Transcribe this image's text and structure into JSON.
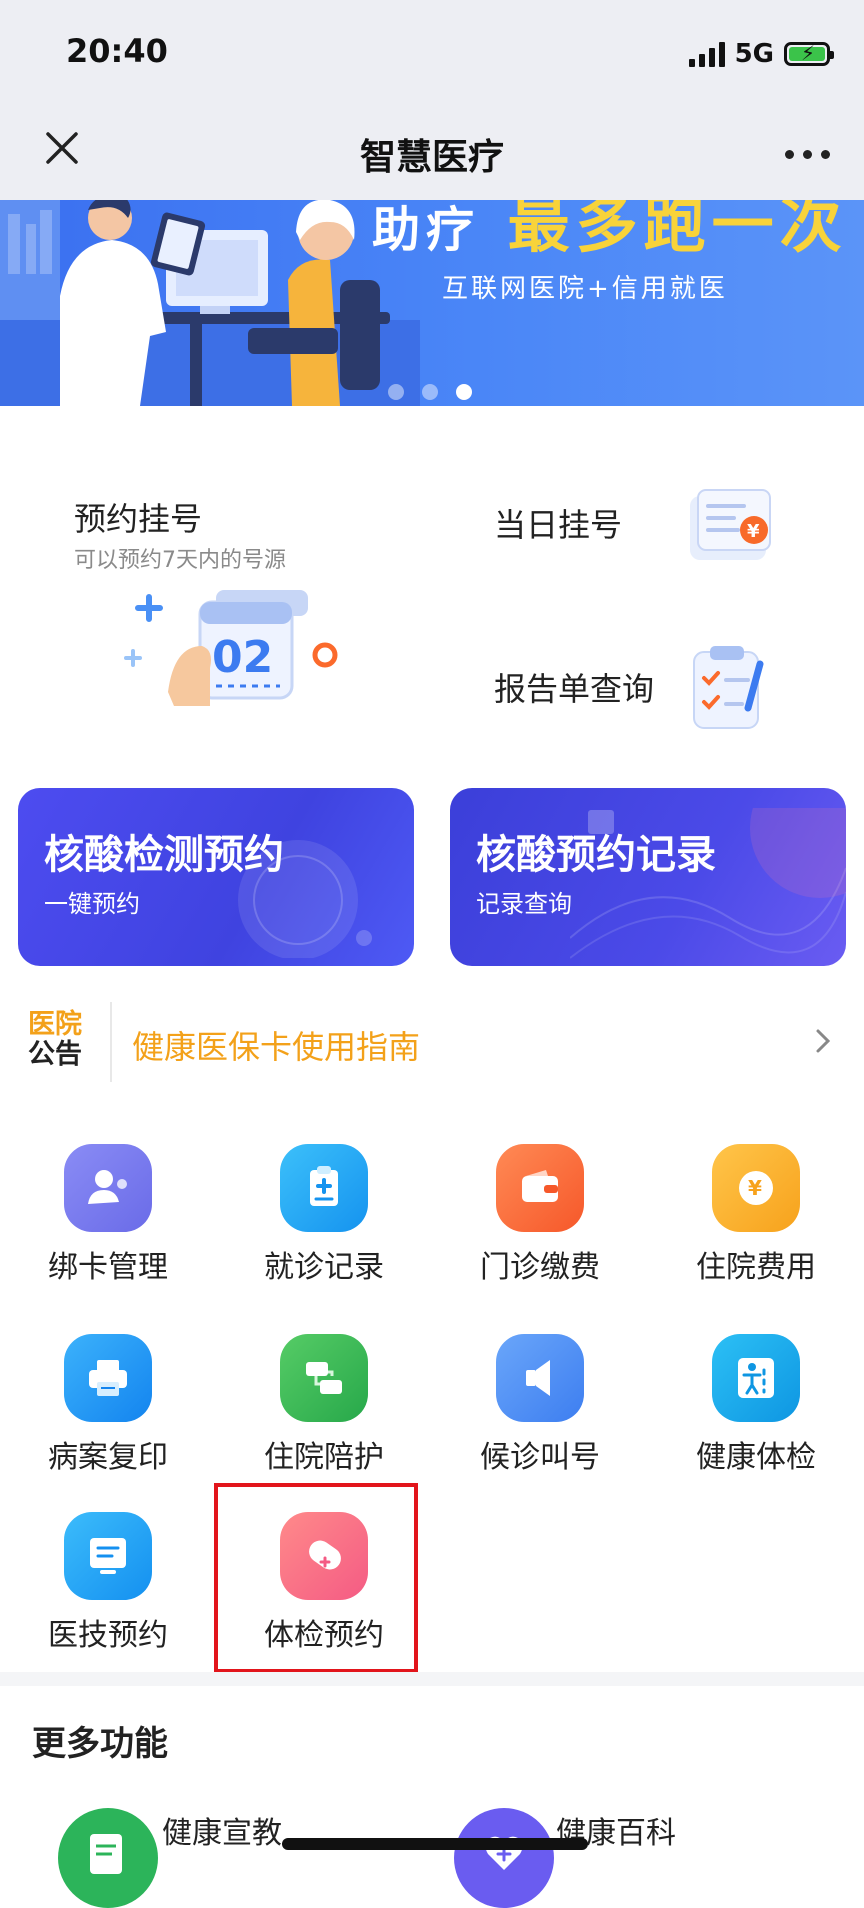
{
  "status": {
    "time": "20:40",
    "network": "5G"
  },
  "header": {
    "title": "智慧医疗"
  },
  "banner": {
    "headline_left": "助疗",
    "headline_main": "最多跑一次",
    "subtitle": "互联网医院+信用就医"
  },
  "quick": {
    "appointment": {
      "title": "预约挂号",
      "subtitle": "可以预约7天内的号源",
      "ticket_number": "02"
    },
    "same_day": {
      "title": "当日挂号"
    },
    "report": {
      "title": "报告单查询"
    }
  },
  "nucleic": {
    "booking": {
      "title": "核酸检测预约",
      "subtitle": "一键预约"
    },
    "records": {
      "title": "核酸预约记录",
      "subtitle": "记录查询"
    }
  },
  "notice": {
    "label_top": "医院",
    "label_bottom": "公告",
    "text": "健康医保卡使用指南"
  },
  "grid": [
    {
      "label": "绑卡管理",
      "icon": "user-card-icon",
      "color": "#7b7cf0"
    },
    {
      "label": "就诊记录",
      "icon": "clipboard-plus-icon",
      "color": "#1fa6f5"
    },
    {
      "label": "门诊缴费",
      "icon": "wallet-icon",
      "color": "#fb6a3d"
    },
    {
      "label": "住院费用",
      "icon": "yen-coin-icon",
      "color": "#fbb02c"
    },
    {
      "label": "病案复印",
      "icon": "printer-icon",
      "color": "#1c9af2"
    },
    {
      "label": "住院陪护",
      "icon": "chat-swap-icon",
      "color": "#36b95a"
    },
    {
      "label": "候诊叫号",
      "icon": "speaker-icon",
      "color": "#4d8ef3"
    },
    {
      "label": "健康体检",
      "icon": "person-chart-icon",
      "color": "#12a6ea"
    },
    {
      "label": "医技预约",
      "icon": "monitor-list-icon",
      "color": "#1a9df4"
    },
    {
      "label": "体检预约",
      "icon": "medical-tag-icon",
      "color": "#f86d86"
    }
  ],
  "more": {
    "title": "更多功能",
    "items": [
      {
        "label": "健康宣教",
        "icon": "document-icon",
        "color": "#2cb45a"
      },
      {
        "label": "健康百科",
        "icon": "heart-plus-icon",
        "color": "#6a5cf0"
      }
    ]
  },
  "highlight_color": "#e2151b"
}
